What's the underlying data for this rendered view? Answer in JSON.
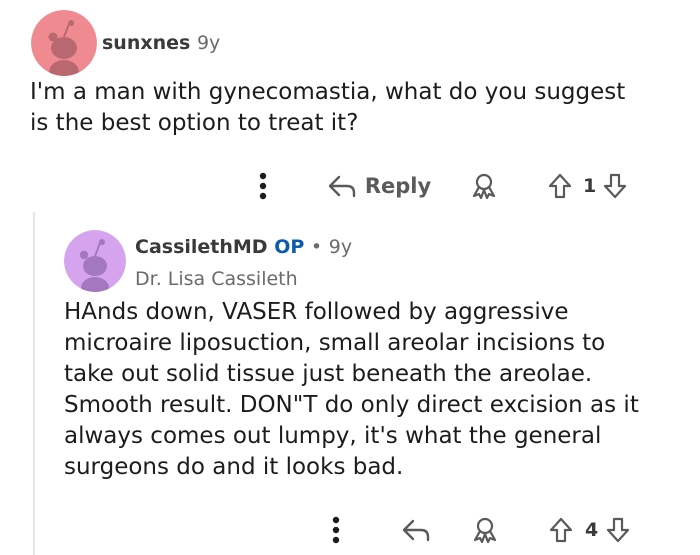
{
  "comments": [
    {
      "username": "sunxnes",
      "age": "9y",
      "body_lines": [
        "I'm a man with gynecomastia, what do you suggest",
        "is the best option to treat it?"
      ],
      "reply_label": "Reply",
      "score": "1",
      "avatar_color": "#f08a91"
    },
    {
      "username": "CassilethMD",
      "op_badge": "OP",
      "separator": "•",
      "age": "9y",
      "flair": "Dr. Lisa Cassileth",
      "body_lines": [
        "HAnds down, VASER followed by aggressive",
        "microaire liposuction, small areolar incisions to",
        "take out solid tissue just beneath the areolae.",
        "Smooth result. DON\"T do only direct excision as it",
        "always comes out lumpy, it's what the general",
        "surgeons do and it looks bad."
      ],
      "score": "4",
      "avatar_color": "#d6a4ef"
    }
  ],
  "icons": {
    "more": "more-options-icon",
    "reply": "reply-arrow-icon",
    "award": "award-icon",
    "upvote": "upvote-arrow-icon",
    "downvote": "downvote-arrow-icon"
  },
  "colors": {
    "op_badge": "#0b5cad",
    "icon_gray": "#5a5a5a",
    "thread_line": "#e4e6e8"
  }
}
